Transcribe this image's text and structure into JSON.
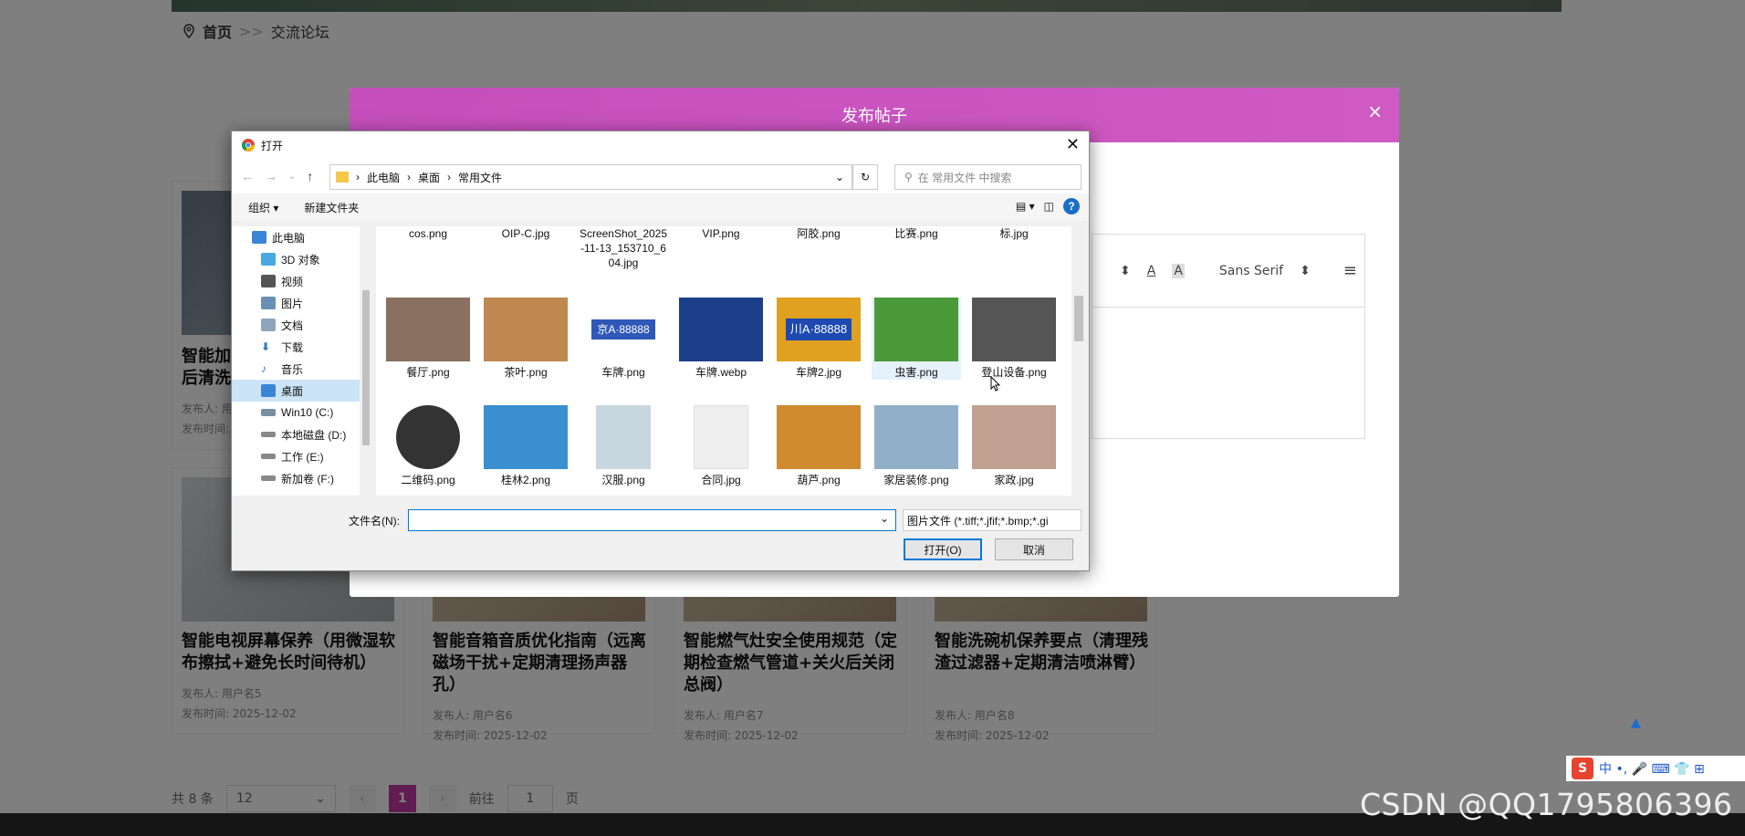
{
  "breadcrumb": {
    "home": "首页",
    "sep": ">>",
    "current": "交流论坛"
  },
  "cards": [
    {
      "title": "智能加\n后清洗",
      "author": "发布人: 用",
      "time": "发布时间:"
    },
    {
      "title": "智能电视屏幕保养（用微湿软布擦拭+避免长时间待机）",
      "author": "发布人: 用户名5",
      "time": "发布时间: 2025-12-02"
    },
    {
      "title": "智能音箱音质优化指南（远离磁场干扰+定期清理扬声器孔）",
      "author": "发布人: 用户名6",
      "time": "发布时间: 2025-12-02"
    },
    {
      "title": "智能燃气灶安全使用规范（定期检查燃气管道+关火后关闭总阀）",
      "author": "发布人: 用户名7",
      "time": "发布时间: 2025-12-02"
    },
    {
      "title": "智能洗碗机保养要点（清理残渣过滤器+定期清洁喷淋臂）",
      "author": "发布人: 用户名8",
      "time": "发布时间: 2025-12-02"
    }
  ],
  "pager": {
    "total": "共 8 条",
    "size": "12",
    "current": "1",
    "goto": "前往",
    "goto_value": "1",
    "unit": "页"
  },
  "modal": {
    "title": "发布帖子",
    "close": "×"
  },
  "editor": {
    "font": "Sans Serif",
    "align_icon": "≡",
    "arrows": "⬍",
    "font_color": "A",
    "font_bg": "A"
  },
  "dialog": {
    "title": "打开",
    "close": "✕",
    "path": [
      "此电脑",
      "桌面",
      "常用文件"
    ],
    "search_placeholder": "在 常用文件 中搜索",
    "organize": "组织 ▾",
    "new_folder": "新建文件夹",
    "tree": [
      {
        "label": "此电脑",
        "color": "#3a86d6",
        "sub": false
      },
      {
        "label": "3D 对象",
        "color": "#4aa8e0",
        "sub": true
      },
      {
        "label": "视频",
        "color": "#555555",
        "sub": true
      },
      {
        "label": "图片",
        "color": "#6a8fb5",
        "sub": true
      },
      {
        "label": "文档",
        "color": "#8fa5bd",
        "sub": true
      },
      {
        "label": "下载",
        "color": "#2a77d0",
        "sub": true
      },
      {
        "label": "音乐",
        "color": "#2a77d0",
        "sub": true
      },
      {
        "label": "桌面",
        "color": "#3a86d6",
        "sub": true
      },
      {
        "label": "Win10 (C:)",
        "color": "#7a8ea3",
        "sub": true
      },
      {
        "label": "本地磁盘 (D:)",
        "color": "#888888",
        "sub": true
      },
      {
        "label": "工作 (E:)",
        "color": "#888888",
        "sub": true
      },
      {
        "label": "新加卷 (F:)",
        "color": "#888888",
        "sub": true
      }
    ],
    "files_row1": [
      "cos.png",
      "OIP-C.jpg",
      "ScreenShot_2025-11-13_153710_604.jpg",
      "VIP.png",
      "阿胶.png",
      "比赛.png",
      "标.jpg"
    ],
    "files_row2": [
      {
        "name": "餐厅.png",
        "color": "#8a7060"
      },
      {
        "name": "茶叶.png",
        "color": "#c08850"
      },
      {
        "name": "车牌.png",
        "color": "#2f59b8"
      },
      {
        "name": "车牌.webp",
        "color": "#1d3f8a"
      },
      {
        "name": "车牌2.jpg",
        "color": "#e0a020"
      },
      {
        "name": "虫害.png",
        "color": "#4a9a3a"
      },
      {
        "name": "登山设备.png",
        "color": "#555555"
      }
    ],
    "files_row3": [
      {
        "name": "二维码.png",
        "color": "#333333"
      },
      {
        "name": "桂林2.png",
        "color": "#3a8fd0"
      },
      {
        "name": "汉服.png",
        "color": "#c8d6e0"
      },
      {
        "name": "合同.jpg",
        "color": "#eeeeee"
      },
      {
        "name": "葫芦.png",
        "color": "#d08a30"
      },
      {
        "name": "家居装修.png",
        "color": "#8fb0c8"
      },
      {
        "name": "家政.jpg",
        "color": "#c0a090"
      }
    ],
    "plate_text": "京A·88888",
    "plate2_text": "川A·88888",
    "filename_label": "文件名(N):",
    "filename_value": "",
    "filetype": "图片文件 (*.tiff;*.jfif;*.bmp;*.gi",
    "open_label": "打开(O)",
    "cancel_label": "取消"
  },
  "ime": {
    "logo": "S",
    "items": "中 •, 🎤 ⌨ 👕 ⊞"
  },
  "watermark": "CSDN @QQ1795806396",
  "colors": {
    "accent": "#c23aa5",
    "modal_header": "#c94fbf",
    "dialog_border": "#0078d7"
  }
}
